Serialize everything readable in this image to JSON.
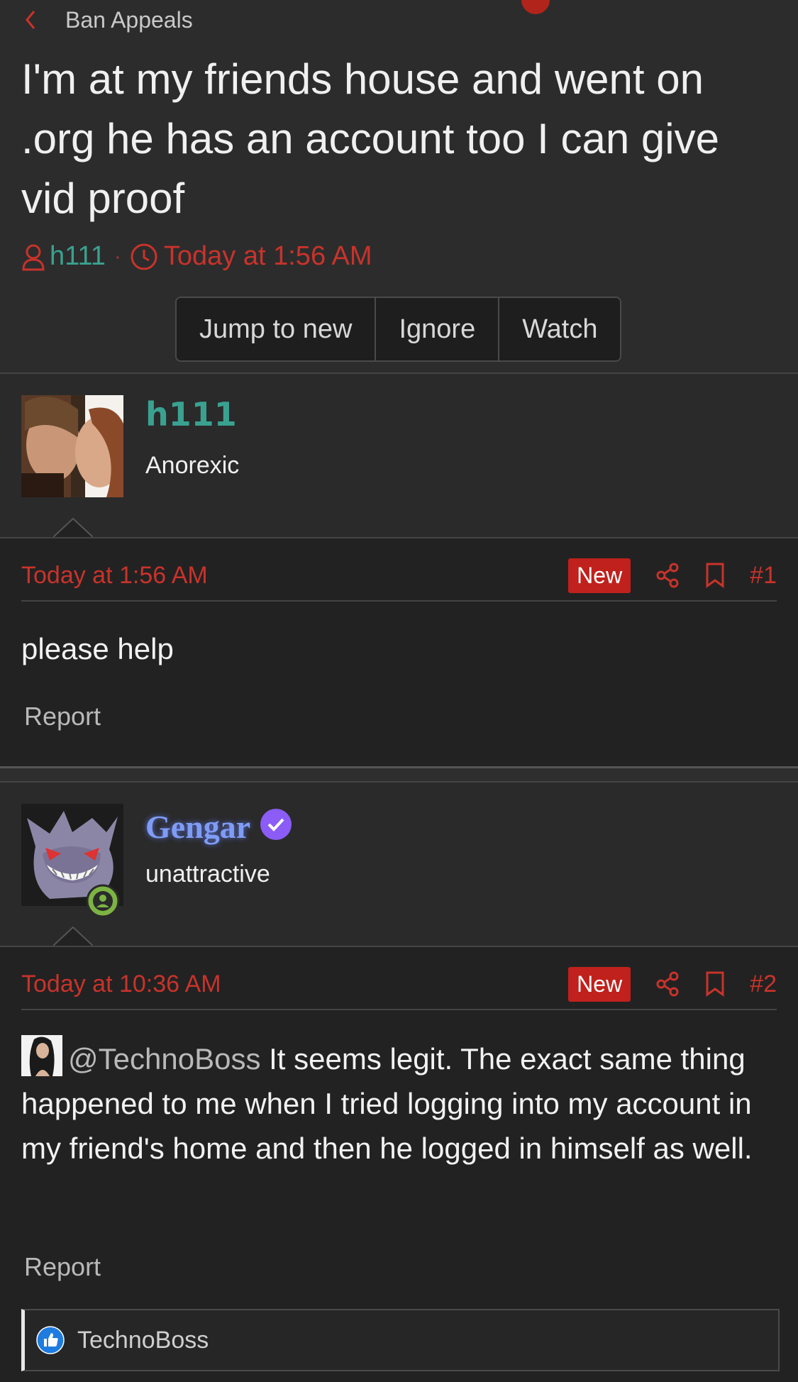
{
  "breadcrumb": {
    "label": "Ban Appeals"
  },
  "thread": {
    "title": "I'm at my friends house and went on .org he has an account too I can give vid proof",
    "author": "h111",
    "separator": "·",
    "time": "Today at 1:56 AM"
  },
  "buttons": {
    "jump": "Jump to new",
    "ignore": "Ignore",
    "watch": "Watch"
  },
  "posts": [
    {
      "username": "h111",
      "user_title": "Anorexic",
      "date": "Today at 1:56 AM",
      "badge": "New",
      "number": "#1",
      "body": "please help",
      "report": "Report"
    },
    {
      "username": "Gengar",
      "user_title": "unattractive",
      "date": "Today at 10:36 AM",
      "badge": "New",
      "number": "#2",
      "mention": "@TechnoBoss",
      "body": "It seems legit. The exact same thing happened to me when I tried logging into my account in my friend's home and then he logged in himself as well.",
      "report": "Report"
    }
  ],
  "reactions": {
    "user": "TechnoBoss",
    "icon": "like-icon"
  },
  "colors": {
    "accent_red": "#c8332b",
    "author_teal": "#3aa190",
    "gengar_blue": "#7f9cf5",
    "verified_purple": "#8b5cf6",
    "online_green": "#7cb342"
  }
}
